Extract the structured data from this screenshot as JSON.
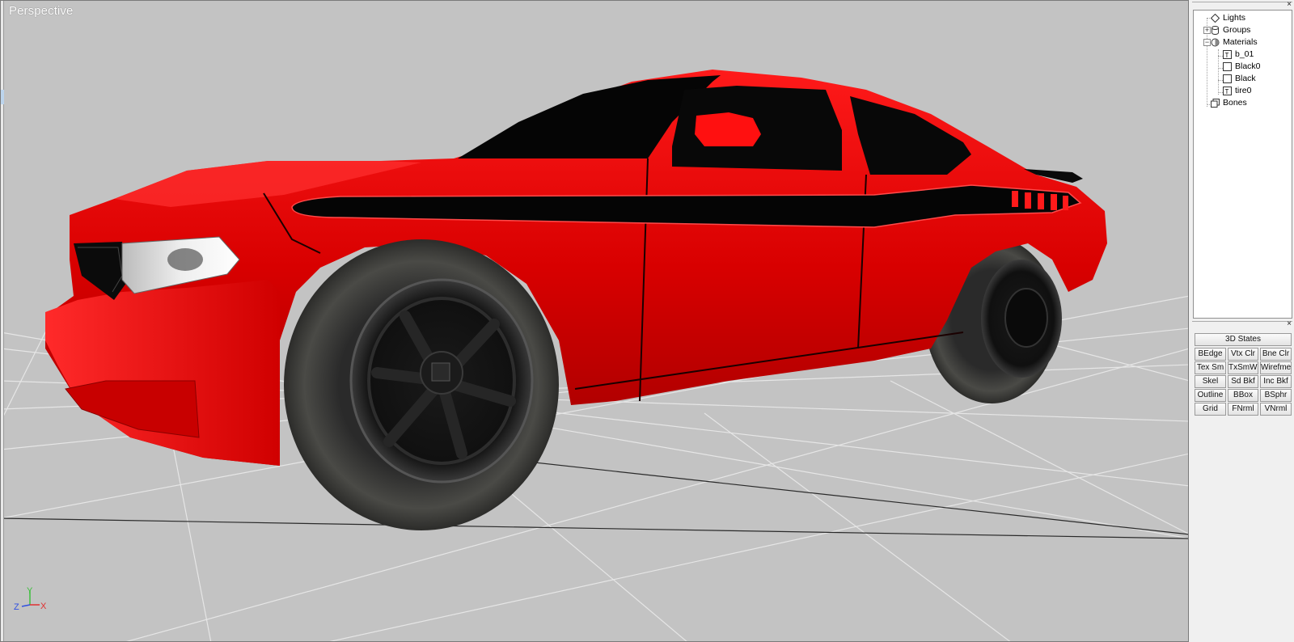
{
  "viewport": {
    "label": "Perspective",
    "gizmo": {
      "x": "X",
      "y": "Y",
      "z": "Z"
    }
  },
  "scene_tree": {
    "items": [
      {
        "label": "Lights",
        "icon": "light-diamond-icon"
      },
      {
        "label": "Groups",
        "icon": "cylinder-icon"
      },
      {
        "label": "Materials",
        "icon": "sphere-icon"
      },
      {
        "label": "b_01",
        "icon": "texture-icon"
      },
      {
        "label": "Black0",
        "icon": "material-square-icon"
      },
      {
        "label": "Black",
        "icon": "material-square-icon"
      },
      {
        "label": "tire0",
        "icon": "texture-icon"
      },
      {
        "label": "Bones",
        "icon": "bones-icon"
      }
    ]
  },
  "states_panel": {
    "title": "3D States",
    "buttons": [
      "BEdge",
      "Vtx Clr",
      "Bne Clr",
      "Tex Sm",
      "TxSmWr",
      "Wirefme",
      "Skel",
      "Sd Bkf",
      "Inc Bkf",
      "Outline",
      "BBox",
      "BSphr",
      "Grid",
      "FNrml",
      "VNrml"
    ]
  },
  "panel_close_label": "×",
  "colors": {
    "viewport_bg": "#c3c3c3",
    "car_body": "#e00000",
    "panel_bg": "#f0f0f0"
  }
}
